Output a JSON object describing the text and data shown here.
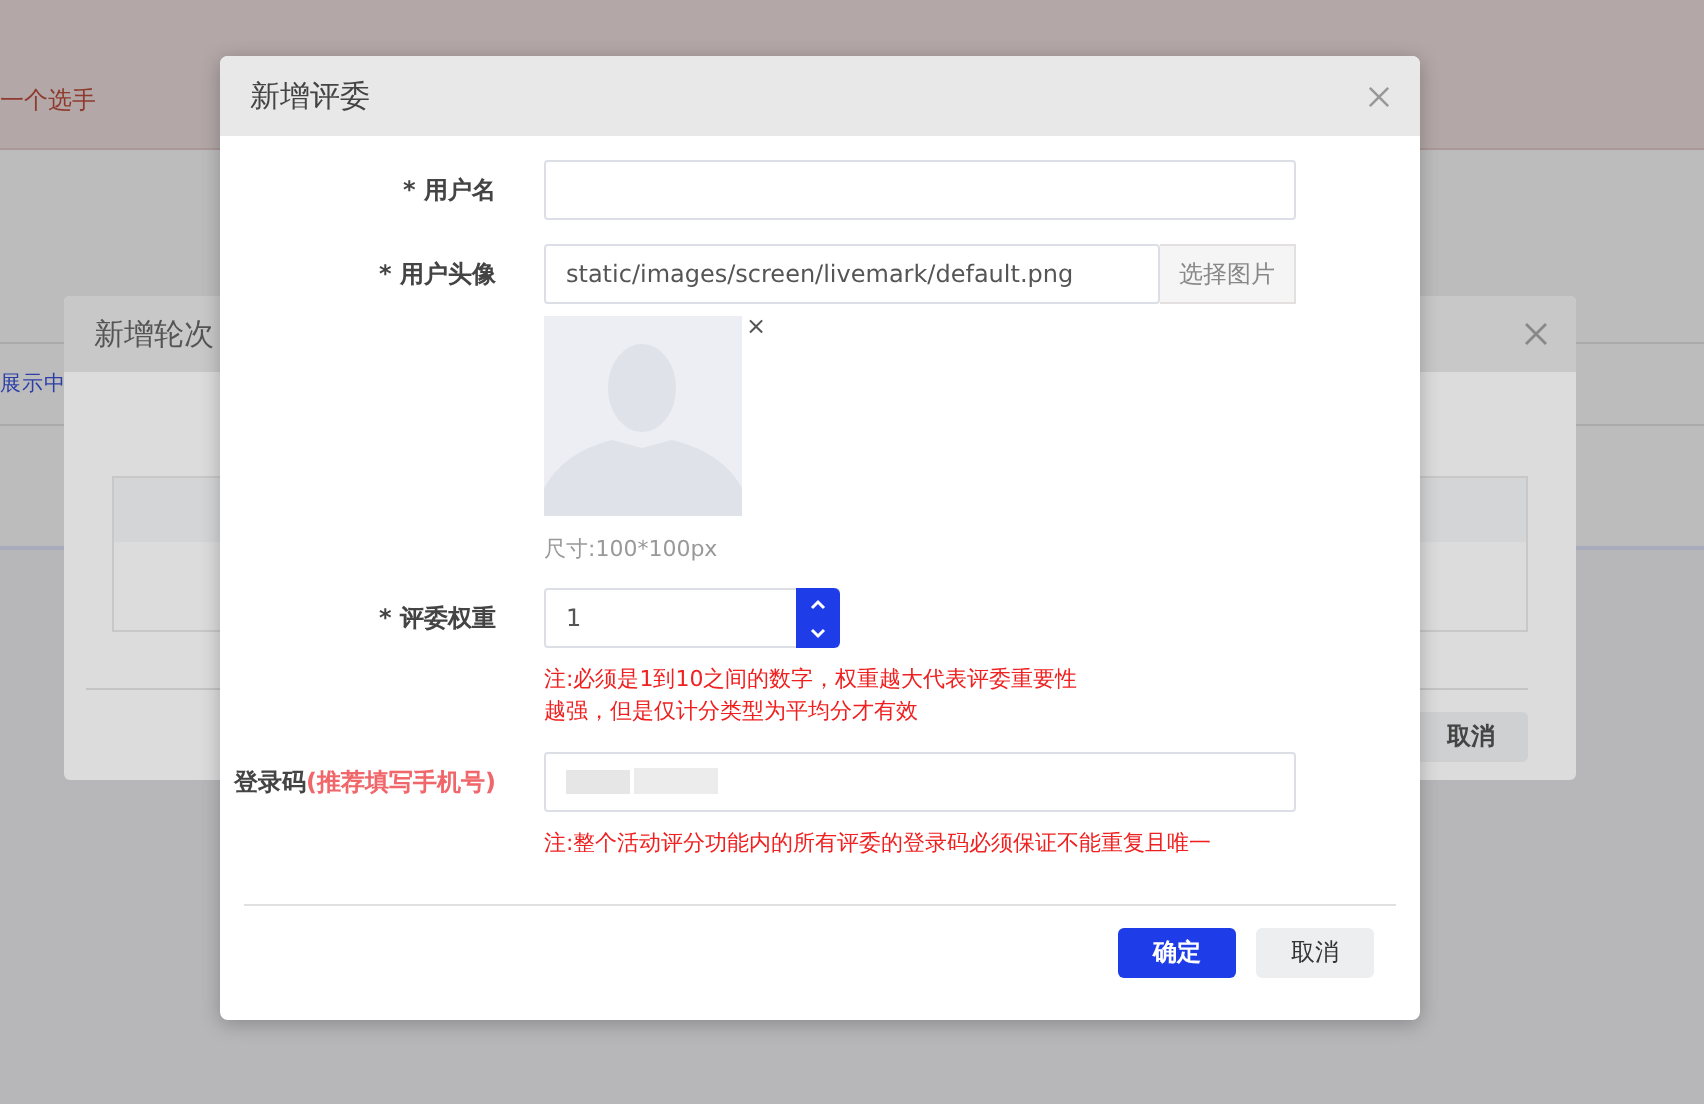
{
  "background_page": {
    "banner_text": "一个选手",
    "status_text": "展示中"
  },
  "background_dialog": {
    "title": "新增轮次",
    "cancel_button": "取消"
  },
  "dialog": {
    "title": "新增评委",
    "fields": [
      {
        "kind": "text",
        "label": "* 用户名"
      },
      {
        "kind": "image",
        "label": "* 用户头像",
        "value": "static/images/screen/livemark/default.png",
        "button": "选择图片",
        "remove": "×",
        "caption": "尺寸:100*100px"
      },
      {
        "kind": "number",
        "label": "* 评委权重",
        "value": "1",
        "note_lines": [
          "注:必须是1到10之间的数字，权重越大代表评委重要性",
          "越强，但是仅计分类型为平均分才有效"
        ]
      },
      {
        "kind": "login",
        "label": "登录码",
        "label_hint": "(推荐填写手机号)",
        "note_lines": [
          "注:整个活动评分功能内的所有评委的登录码必须保证不能重复且唯一"
        ]
      }
    ],
    "confirm_button": "确定",
    "cancel_button": "取消"
  }
}
